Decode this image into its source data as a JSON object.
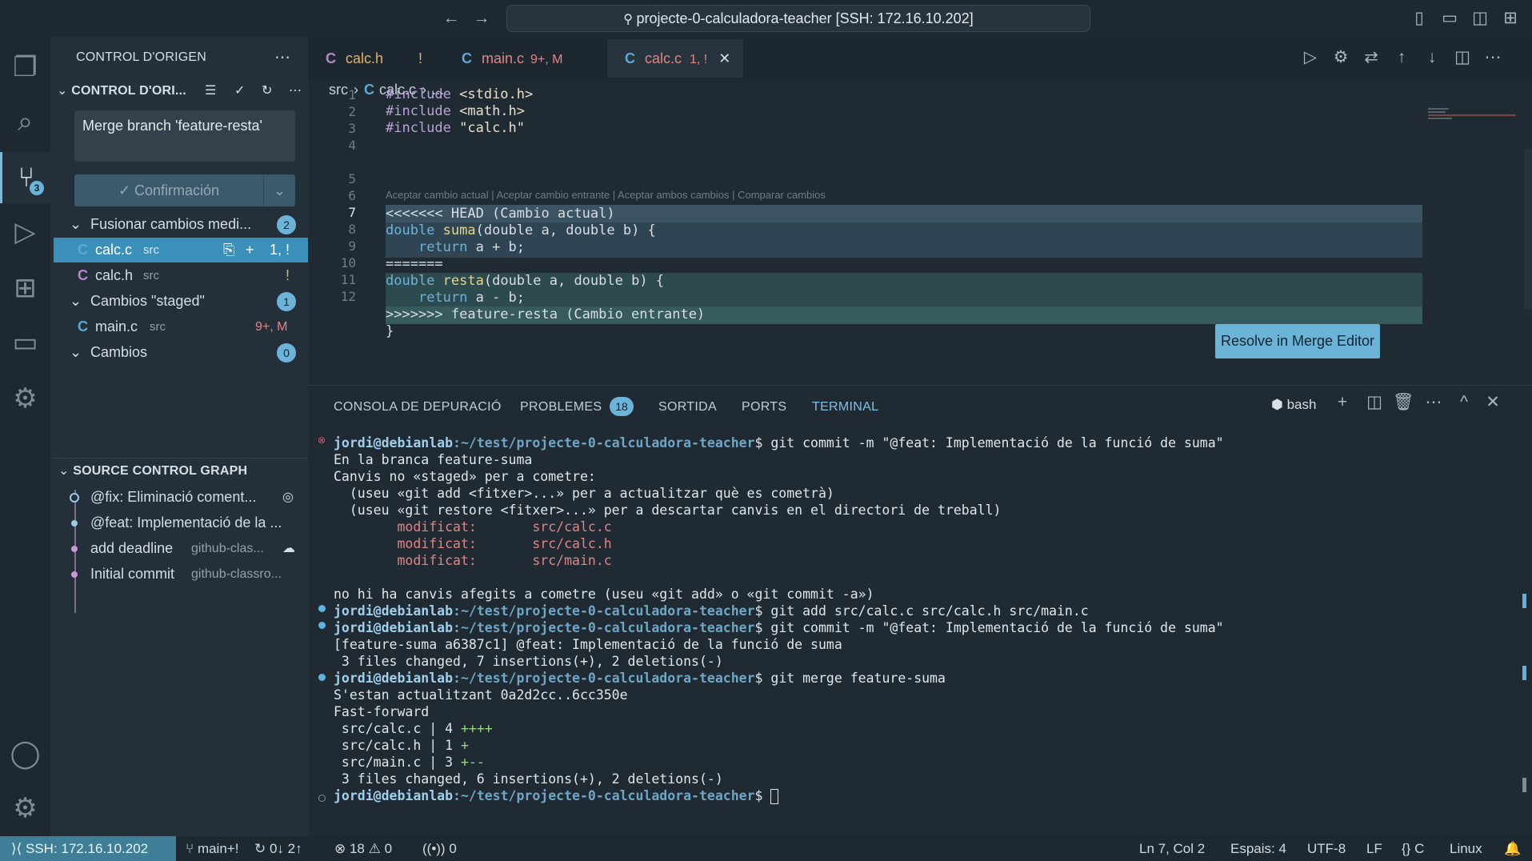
{
  "titlebar": {
    "command_center": "projecte-0-calculadora-teacher [SSH: 172.16.10.202]"
  },
  "activity": {
    "scm_badge": "3"
  },
  "sidebar": {
    "title": "CONTROL D'ORIGEN",
    "repo_header": "CONTROL D'ORI...",
    "commit_message": "Merge branch 'feature-resta'",
    "commit_button": "✓ Confirmación",
    "groups": [
      {
        "label": "Fusionar cambios medi...",
        "count": "2"
      },
      {
        "label": "Cambios \"staged\"",
        "count": "1"
      },
      {
        "label": "Cambios",
        "count": "0"
      }
    ],
    "files": [
      {
        "name": "calc.c",
        "dir": "src",
        "status": "1, !"
      },
      {
        "name": "calc.h",
        "dir": "src",
        "status": "!"
      },
      {
        "name": "main.c",
        "dir": "src",
        "status": "9+, M"
      }
    ],
    "graph_title": "SOURCE CONTROL GRAPH",
    "graph": [
      {
        "msg": "@fix: Eliminació coment...",
        "ref": ""
      },
      {
        "msg": "@feat: Implementació de la ...",
        "ref": ""
      },
      {
        "msg": "add deadline",
        "ref": "github-clas..."
      },
      {
        "msg": "Initial commit",
        "ref": "github-classro..."
      }
    ]
  },
  "tabs": [
    {
      "name": "calc.h",
      "status": "!"
    },
    {
      "name": "main.c",
      "status": "9+, M"
    },
    {
      "name": "calc.c",
      "status": "1, !"
    }
  ],
  "breadcrumb": {
    "folder": "src",
    "file": "calc.c",
    "more": "..."
  },
  "codelens": "Aceptar cambio actual | Aceptar cambio entrante | Aceptar ambos cambios | Comparar cambios",
  "resolve_button": "Resolve in Merge Editor",
  "code": {
    "l1a": "#include",
    "l1b": " <stdio.h>",
    "l2a": "#include",
    "l2b": " <math.h>",
    "l3a": "#include",
    "l3b": " \"calc.h\"",
    "l5": "<<<<<<< HEAD (Cambio actual)",
    "double": "double",
    "suma": "suma",
    "resta": "resta",
    "args": "(double a, double b) {",
    "ret_kw": "return",
    "ret_sum": " a + b;",
    "ret_sub": " a - b;",
    "l8": "=======",
    "l11": ">>>>>>> feature-resta (Cambio entrante)",
    "l12": "}"
  },
  "panel": {
    "tabs": [
      "CONSOLA DE DEPURACIÓ",
      "PROBLEMES",
      "SORTIDA",
      "PORTS",
      "TERMINAL"
    ],
    "problems_count": "18",
    "shell": "bash"
  },
  "terminal": {
    "prompt": "jordi@debianlab",
    "path": ":~/test/projecte-0-calculadora-teacher",
    "cmd1": "$ git commit -m \"@feat: Implementació de la funció de suma\"",
    "o1": "En la branca feature-suma",
    "o2": "Canvis no «staged» per a cometre:",
    "o3": "  (useu «git add <fitxer>...» per a actualitzar què es cometrà)",
    "o4": "  (useu «git restore <fitxer>...» per a descartar canvis en el directori de treball)",
    "m1": "        modificat:       src/calc.c",
    "m2": "        modificat:       src/calc.h",
    "m3": "        modificat:       src/main.c",
    "o5": "no hi ha canvis afegits a cometre (useu «git add» o «git commit -a»)",
    "cmd2": "$ git add src/calc.c src/calc.h src/main.c",
    "cmd3": "$ git commit -m \"@feat: Implementació de la funció de suma\"",
    "o6": "[feature-suma a6387c1] @feat: Implementació de la funció de suma",
    "o7": " 3 files changed, 7 insertions(+), 2 deletions(-)",
    "cmd4": "$ git merge feature-suma",
    "o8": "S'estan actualitzant 0a2d2cc..6cc350e",
    "o9": "Fast-forward",
    "d1a": " src/calc.c | 4 ",
    "d1b": "++++",
    "d2a": " src/calc.h | 1 ",
    "d2b": "+",
    "d3a": " src/main.c | 3 ",
    "d3b": "+--",
    "o10": " 3 files changed, 6 insertions(+), 2 deletions(-)",
    "cmd5": "$ "
  },
  "status": {
    "remote": "SSH: 172.16.10.202",
    "branch": "main+!",
    "sync": "0↓ 2↑",
    "errors": "18",
    "warnings": "0",
    "ports": "0",
    "position": "Ln 7, Col 2",
    "spaces": "Espais: 4",
    "encoding": "UTF-8",
    "eol": "LF",
    "language": "C",
    "os": "Linux"
  }
}
